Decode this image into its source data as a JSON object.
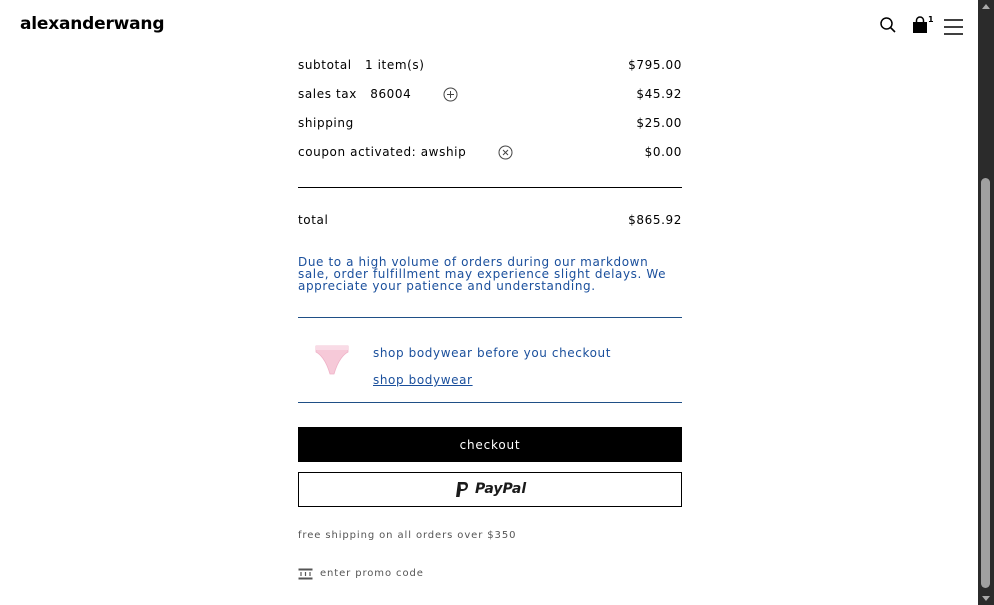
{
  "header": {
    "logo": "alexanderwang",
    "cart_count": "1"
  },
  "summary": {
    "subtotal": {
      "label": "subtotal",
      "items": "1 item(s)",
      "value": "$795.00"
    },
    "sales_tax": {
      "label": "sales tax",
      "zip": "86004",
      "value": "$45.92"
    },
    "shipping": {
      "label": "shipping",
      "value": "$25.00"
    },
    "coupon": {
      "label": "coupon activated: awship",
      "value": "$0.00"
    },
    "total": {
      "label": "total",
      "value": "$865.92"
    }
  },
  "notice": "Due to a high volume of orders during our markdown sale, order fulfillment may experience slight delays. We appreciate your patience and understanding.",
  "promo": {
    "title": "shop bodywear before you checkout",
    "link": "shop bodywear"
  },
  "actions": {
    "checkout": "checkout",
    "paypal": "PayPal"
  },
  "footer": {
    "free_shipping": "free shipping on all orders over $350",
    "promo_code": "enter promo code"
  },
  "colors": {
    "accent_blue": "#1a4f9c",
    "button_bg": "#000000"
  },
  "icons": [
    "search-icon",
    "shopping-bag-icon",
    "hamburger-menu-icon",
    "plus-circle-icon",
    "close-circle-icon",
    "paypal-logo-icon",
    "promo-ticket-icon"
  ]
}
